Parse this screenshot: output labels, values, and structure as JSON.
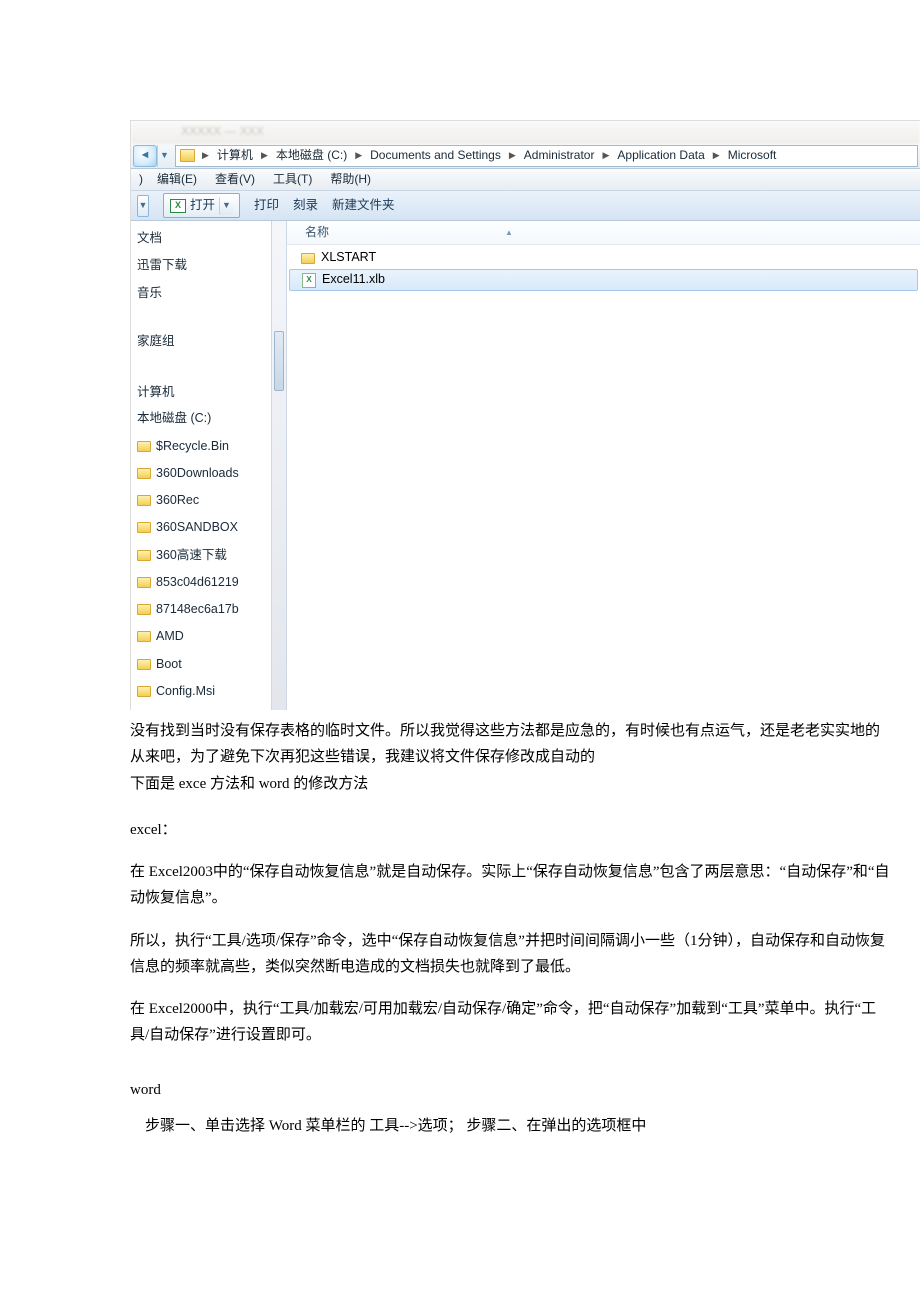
{
  "explorer": {
    "breadcrumb": [
      "计算机",
      "本地磁盘 (C:)",
      "Documents and Settings",
      "Administrator",
      "Application Data",
      "Microsoft"
    ],
    "menubar_prefix": ")",
    "menu": {
      "edit": "编辑(E)",
      "view": "查看(V)",
      "tools": "工具(T)",
      "help": "帮助(H)"
    },
    "toolbar": {
      "open": "打开",
      "print": "打印",
      "burn": "刻录",
      "newfolder": "新建文件夹"
    },
    "columns": {
      "name": "名称"
    },
    "sidebar": {
      "items_top": [
        "文档",
        "迅雷下载",
        "音乐"
      ],
      "homegroup": "家庭组",
      "computer": "计算机",
      "drive": "本地磁盘 (C:)",
      "folders": [
        "$Recycle.Bin",
        "360Downloads",
        "360Rec",
        "360SANDBOX",
        "360高速下载",
        "853c04d61219",
        "87148ec6a17b",
        "AMD",
        "Boot",
        "Config.Msi"
      ]
    },
    "files": {
      "folder1": "XLSTART",
      "file1": "Excel11.xlb"
    }
  },
  "article": {
    "p1": "没有找到当时没有保存表格的临时文件。所以我觉得这些方法都是应急的，有时候也有点运气，还是老老实实地的从来吧，为了避免下次再犯这些错误，我建议将文件保存修改成自动的",
    "p2": "下面是 exce 方法和 word 的修改方法",
    "h_excel": "excel：",
    "p3": "在 Excel2003中的“保存自动恢复信息”就是自动保存。实际上“保存自动恢复信息”包含了两层意思：“自动保存”和“自动恢复信息”。",
    "p4": "所以，执行“工具/选项/保存”命令，选中“保存自动恢复信息”并把时间间隔调小一些（1分钟），自动保存和自动恢复信息的频率就高些，类似突然断电造成的文档损失也就降到了最低。",
    "p5": "在 Excel2000中，执行“工具/加载宏/可用加载宏/自动保存/确定”命令，把“自动保存”加载到“工具”菜单中。执行“工具/自动保存”进行设置即可。",
    "h_word": "word",
    "p6": "步骤一、单击选择 Word 菜单栏的 工具-->选项；  步骤二、在弹出的选项框中"
  }
}
